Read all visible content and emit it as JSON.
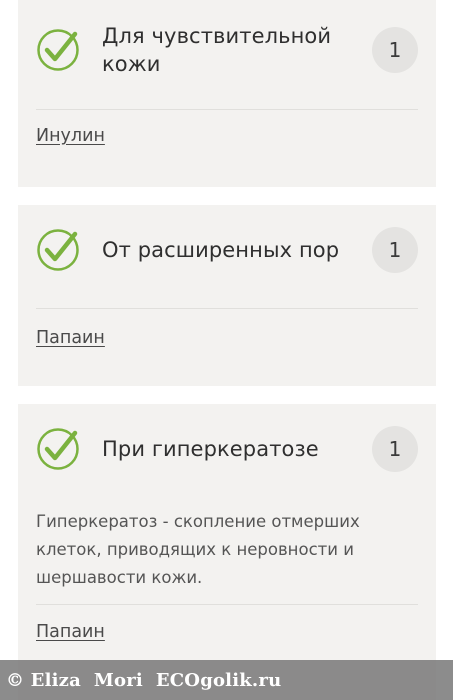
{
  "colors": {
    "card_background": "#f3f2f0",
    "check_green": "#7bb23f",
    "badge_background": "#e4e3e1",
    "watermark_background": "#7a7a7a"
  },
  "cards": [
    {
      "icon": "check-circle-icon",
      "title": "Для чувствительной кожи",
      "count": "1",
      "ingredient": "Инулин"
    },
    {
      "icon": "check-circle-icon",
      "title": "От расширенных пор",
      "count": "1",
      "ingredient": "Папаин"
    },
    {
      "icon": "check-circle-icon",
      "title": "При гиперкератозе",
      "count": "1",
      "description": "Гиперкератоз - скопление отмерших клеток, приводящих к неровности и шершавости кожи.",
      "ingredient": "Папаин"
    }
  ],
  "watermark": {
    "text": "© Eliza  Mori  ECOgolik.ru"
  }
}
